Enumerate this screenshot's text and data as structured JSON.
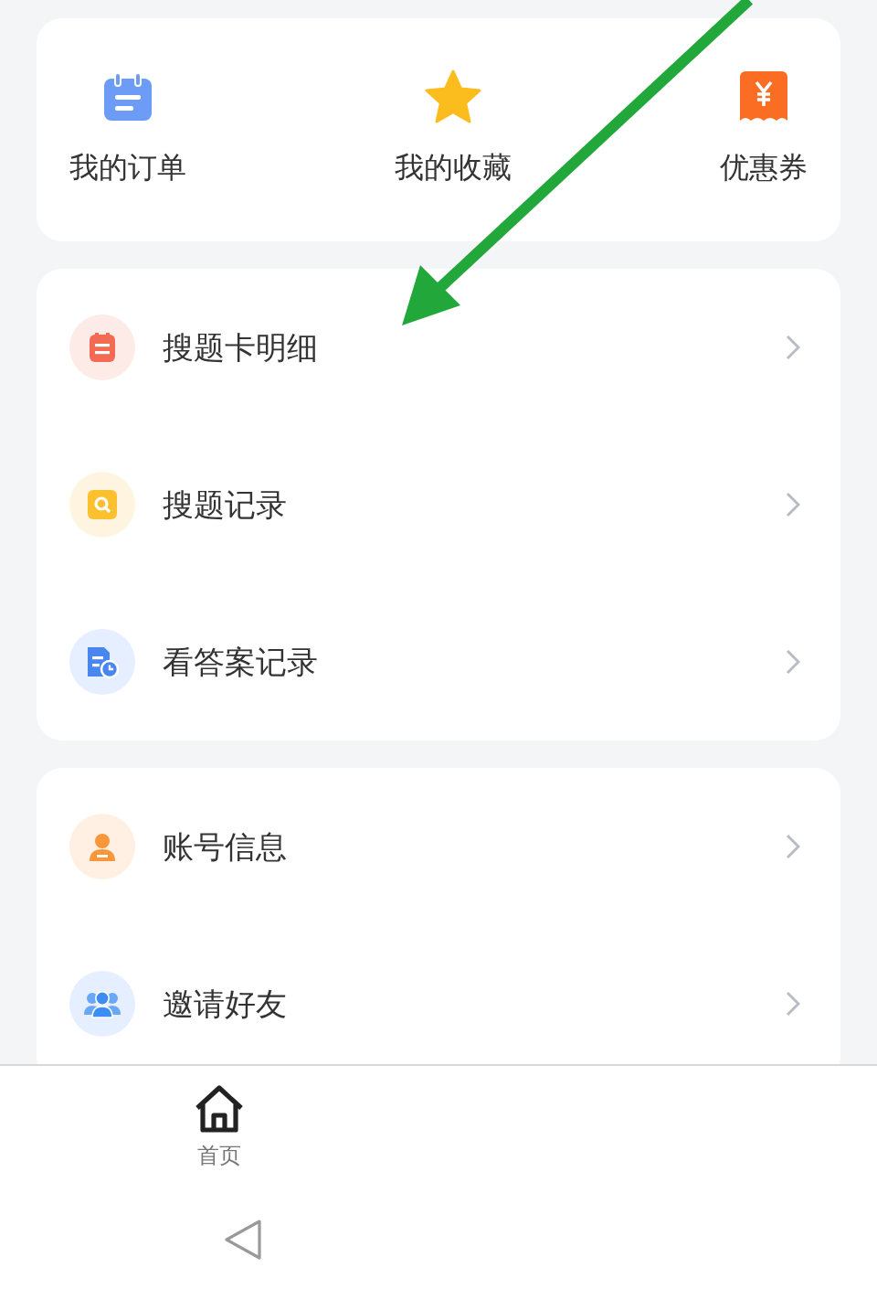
{
  "shortcuts": [
    {
      "label": "我的订单"
    },
    {
      "label": "我的收藏"
    },
    {
      "label": "优惠券"
    }
  ],
  "menu_groups": [
    {
      "items": [
        {
          "label": "搜题卡明细"
        },
        {
          "label": "搜题记录"
        },
        {
          "label": "看答案记录"
        }
      ]
    },
    {
      "items": [
        {
          "label": "账号信息"
        },
        {
          "label": "邀请好友"
        }
      ]
    }
  ],
  "tab_bar": {
    "tabs": [
      {
        "label": "首页",
        "selected": true
      }
    ]
  },
  "annotations": [
    {
      "kind": "arrow"
    }
  ]
}
